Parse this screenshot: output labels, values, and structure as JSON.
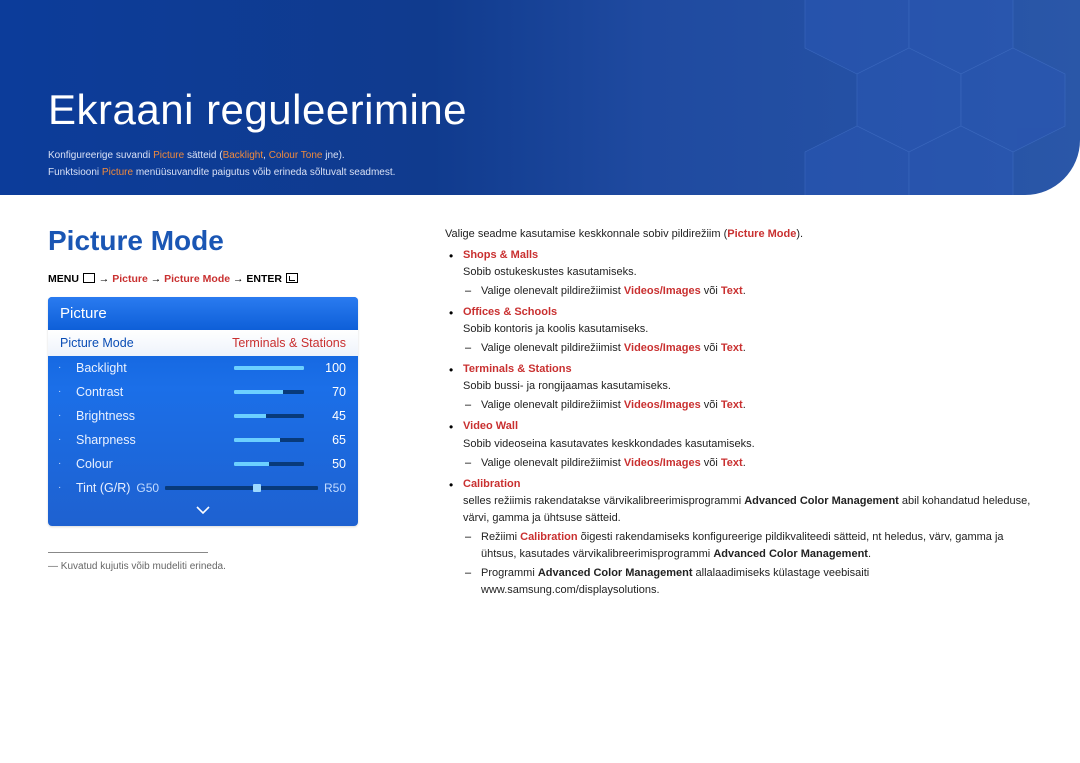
{
  "hero": {
    "title": "Ekraani reguleerimine",
    "intro1_pre": "Konfigureerige suvandi ",
    "intro1_hl1": "Picture",
    "intro1_mid": " sätteid (",
    "intro1_hl2": "Backlight",
    "intro1_comma": ", ",
    "intro1_hl3": "Colour Tone",
    "intro1_post": " jne).",
    "intro2_pre": "Funktsiooni ",
    "intro2_hl": "Picture",
    "intro2_post": " menüüsuvandite paigutus võib erineda sõltuvalt seadmest."
  },
  "section": {
    "title": "Picture Mode",
    "breadcrumb": {
      "menu": "MENU",
      "arrow": " → ",
      "seg1": "Picture",
      "seg2": "Picture Mode",
      "enter": "ENTER"
    }
  },
  "panel": {
    "title": "Picture",
    "header_label": "Picture Mode",
    "header_value": "Terminals & Stations",
    "rows": [
      {
        "label": "Backlight",
        "value": "100",
        "fill_pct": 100
      },
      {
        "label": "Contrast",
        "value": "70",
        "fill_pct": 70
      },
      {
        "label": "Brightness",
        "value": "45",
        "fill_pct": 45
      },
      {
        "label": "Sharpness",
        "value": "65",
        "fill_pct": 65
      },
      {
        "label": "Colour",
        "value": "50",
        "fill_pct": 50
      }
    ],
    "tint": {
      "label": "Tint (G/R)",
      "left": "G50",
      "right": "R50",
      "knob_pct": 60
    }
  },
  "footnote": "― Kuvatud kujutis võib mudeliti erineda.",
  "right": {
    "lead_pre": "Valige seadme kasutamise keskkonnale sobiv pildirežiim (",
    "lead_hl": "Picture Mode",
    "lead_post": ").",
    "modes": [
      {
        "name": "Shops & Malls",
        "desc": "Sobib ostukeskustes kasutamiseks.",
        "sub": [
          {
            "pre": "Valige olenevalt pildirežiimist ",
            "hl1": "Videos/Images",
            "mid": " või ",
            "hl2": "Text",
            "post": "."
          }
        ]
      },
      {
        "name": "Offices & Schools",
        "desc": "Sobib kontoris ja koolis kasutamiseks.",
        "sub": [
          {
            "pre": "Valige olenevalt pildirežiimist ",
            "hl1": "Videos/Images",
            "mid": " või ",
            "hl2": "Text",
            "post": "."
          }
        ]
      },
      {
        "name": "Terminals & Stations",
        "desc": "Sobib bussi- ja rongijaamas kasutamiseks.",
        "sub": [
          {
            "pre": "Valige olenevalt pildirežiimist ",
            "hl1": "Videos/Images",
            "mid": " või ",
            "hl2": "Text",
            "post": "."
          }
        ]
      },
      {
        "name": "Video Wall",
        "desc": "Sobib videoseina kasutavates keskkondades kasutamiseks.",
        "sub": [
          {
            "pre": "Valige olenevalt pildirežiimist ",
            "hl1": "Videos/Images",
            "mid": " või ",
            "hl2": "Text",
            "post": "."
          }
        ]
      },
      {
        "name": "Calibration",
        "desc_pre": "selles režiimis rakendatakse värvikalibreerimisprogrammi ",
        "desc_strong": "Advanced Color Management",
        "desc_post": " abil kohandatud heleduse, värvi, gamma ja ühtsuse sätteid.",
        "sub": [
          {
            "text_pre": "Režiimi ",
            "text_hl": "Calibration",
            "text_mid": " õigesti rakendamiseks konfigureerige pildikvaliteedi sätteid, nt heledus, värv, gamma ja ühtsus, kasutades värvikalibreerimisprogrammi ",
            "text_strong": "Advanced Color Management",
            "text_post": "."
          },
          {
            "text2_pre": "Programmi ",
            "text2_strong": "Advanced Color Management",
            "text2_post": " allalaadimiseks külastage veebisaiti www.samsung.com/displaysolutions."
          }
        ]
      }
    ]
  }
}
